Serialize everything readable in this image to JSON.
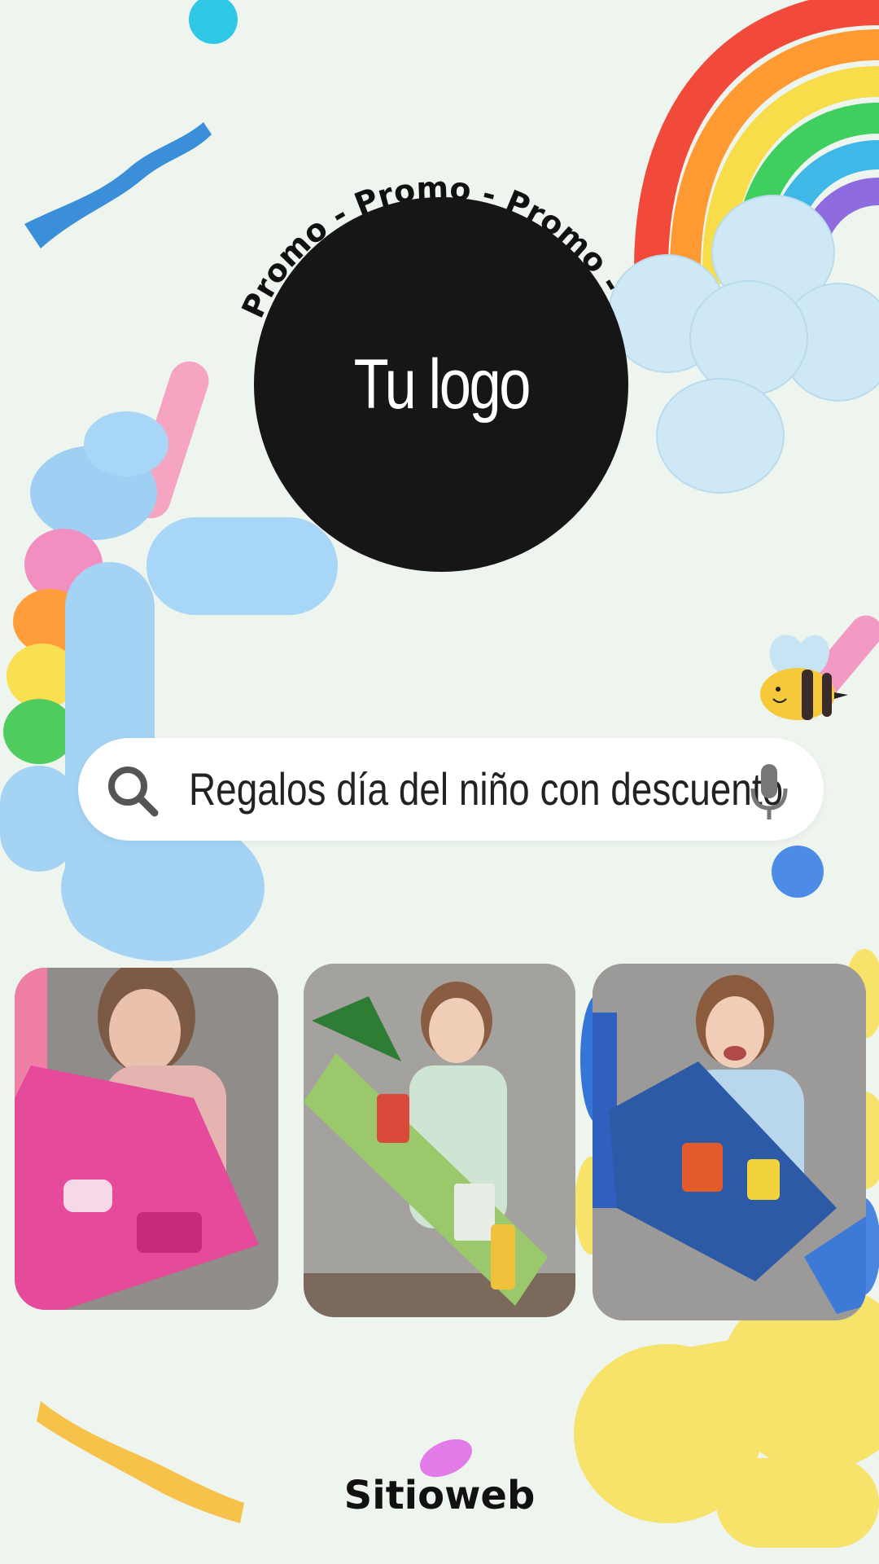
{
  "logo": {
    "text": "Tu logo",
    "ring_text": "Promo - Promo - Promo -"
  },
  "search": {
    "query": "Regalos día del niño con descuento",
    "icon": "search-icon",
    "mic_icon": "microphone-icon"
  },
  "gallery": {
    "photos": [
      {
        "label": "girl-with-pink-candy-bouquet"
      },
      {
        "label": "girl-with-green-candy-bouquet"
      },
      {
        "label": "girl-with-blue-candy-bouquet"
      }
    ]
  },
  "footer": {
    "site": "Sitioweb"
  },
  "colors": {
    "background": "#eef5ef",
    "logo_circle": "#161616",
    "search_bg": "#ffffff"
  }
}
